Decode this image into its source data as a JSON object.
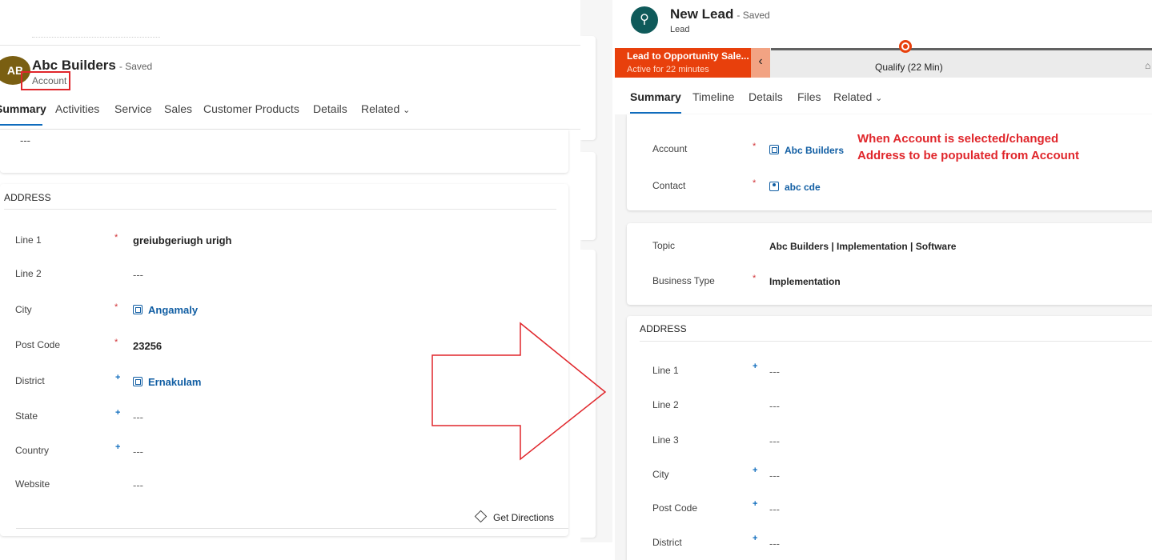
{
  "left": {
    "avatar_initials": "AB",
    "record_title": "Abc Builders",
    "saved_status": "- Saved",
    "entity_type": "Account",
    "tabs": [
      "Summary",
      "Activities",
      "Service",
      "Sales",
      "Customer Products",
      "Details",
      "Related"
    ],
    "top_value": "---",
    "address_section": {
      "title": "ADDRESS",
      "fields": [
        {
          "label": "Line 1",
          "required": "*",
          "value": "greiubgeriugh urigh"
        },
        {
          "label": "Line 2",
          "value": "---"
        },
        {
          "label": "City",
          "required": "*",
          "value": "Angamaly"
        },
        {
          "label": "Post Code",
          "required": "*",
          "value": "23256"
        },
        {
          "label": "District",
          "recommended": "+",
          "value": "Ernakulam"
        },
        {
          "label": "State",
          "recommended": "+",
          "value": "---"
        },
        {
          "label": "Country",
          "recommended": "+",
          "value": "---"
        },
        {
          "label": "Website",
          "value": "---"
        }
      ],
      "get_directions": "Get Directions"
    }
  },
  "right": {
    "record_title": "New Lead",
    "saved_status": "- Saved",
    "entity_type": "Lead",
    "bpf": {
      "process_name": "Lead to Opportunity Sale...",
      "active_time": "Active for 22 minutes",
      "current_stage": "Qualify  (22 Min)"
    },
    "tabs": [
      "Summary",
      "Timeline",
      "Details",
      "Files",
      "Related"
    ],
    "general": {
      "account_label": "Account",
      "account_value": "Abc Builders",
      "contact_label": "Contact",
      "contact_value": "abc cde",
      "required": "*"
    },
    "annotation": {
      "line1": "When Account is selected/changed",
      "line2": "Address to be populated from Account"
    },
    "topic_section": {
      "topic_label": "Topic",
      "topic_value": "Abc Builders |  Implementation | Software",
      "business_type_label": "Business Type",
      "business_type_value": "Implementation"
    },
    "address_section": {
      "title": "ADDRESS",
      "fields": [
        {
          "label": "Line 1",
          "recommended": "+",
          "value": "---"
        },
        {
          "label": "Line 2",
          "value": "---"
        },
        {
          "label": "Line 3",
          "value": "---"
        },
        {
          "label": "City",
          "recommended": "+",
          "value": "---"
        },
        {
          "label": "Post Code",
          "recommended": "+",
          "value": "---"
        },
        {
          "label": "District",
          "recommended": "+",
          "value": "---"
        }
      ]
    }
  },
  "colors": {
    "accent_blue": "#0f6cbd",
    "bpf_orange": "#e8400c",
    "annotation_red": "#e0262b",
    "avatar_brown": "#7a5f12",
    "lead_icon_teal": "#0f5a5a"
  },
  "icons": [
    "lookup-icon",
    "contact-icon",
    "chevron-down-icon",
    "chevron-left-icon",
    "directions-icon",
    "lead-icon",
    "lock-icon",
    "arrow-right-icon"
  ]
}
